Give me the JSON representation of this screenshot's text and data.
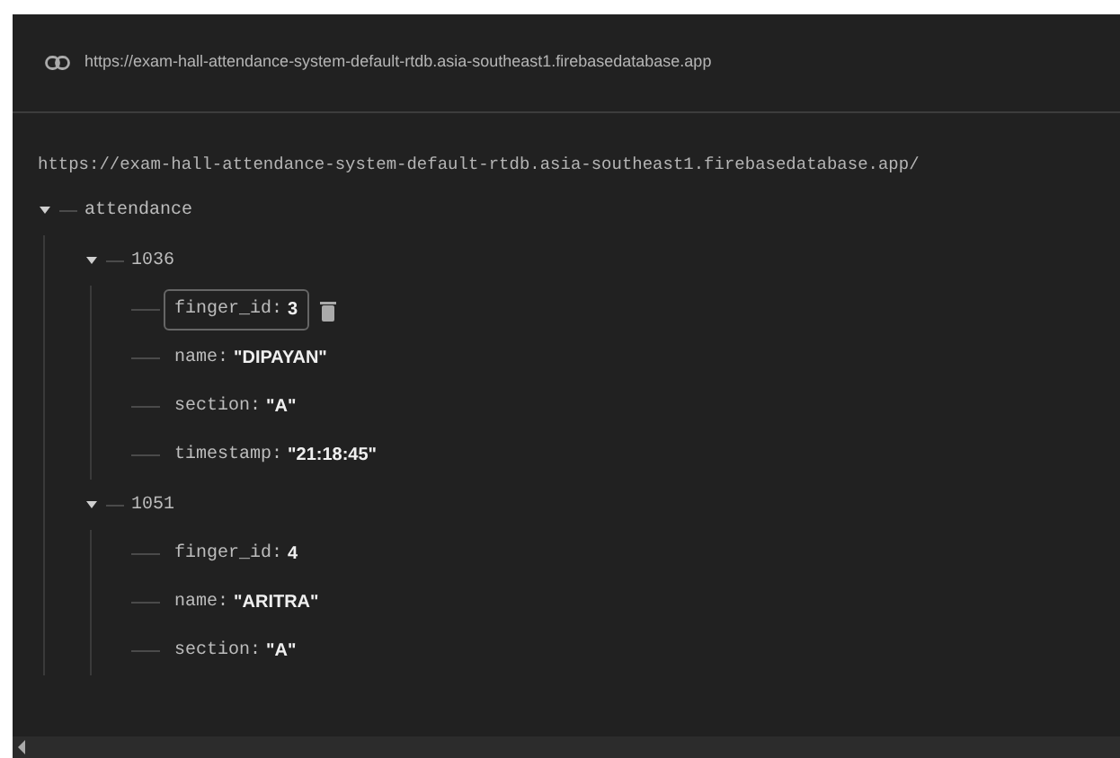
{
  "header": {
    "url": "https://exam-hall-attendance-system-default-rtdb.asia-southeast1.firebasedatabase.app"
  },
  "root_url": "https://exam-hall-attendance-system-default-rtdb.asia-southeast1.firebasedatabase.app/",
  "tree": [
    {
      "key": "attendance",
      "expanded": true,
      "children": [
        {
          "key": "1036",
          "expanded": true,
          "children": [
            {
              "key": "finger_id:",
              "value": "3",
              "selected": true
            },
            {
              "key": "name:",
              "value": "\"DIPAYAN\"",
              "selected": false
            },
            {
              "key": "section:",
              "value": "\"A\"",
              "selected": false
            },
            {
              "key": "timestamp:",
              "value": "\"21:18:45\"",
              "selected": false
            }
          ]
        },
        {
          "key": "1051",
          "expanded": true,
          "children": [
            {
              "key": "finger_id:",
              "value": "4",
              "selected": false
            },
            {
              "key": "name:",
              "value": "\"ARITRA\"",
              "selected": false
            },
            {
              "key": "section:",
              "value": "\"A\"",
              "selected": false
            }
          ]
        }
      ]
    }
  ]
}
